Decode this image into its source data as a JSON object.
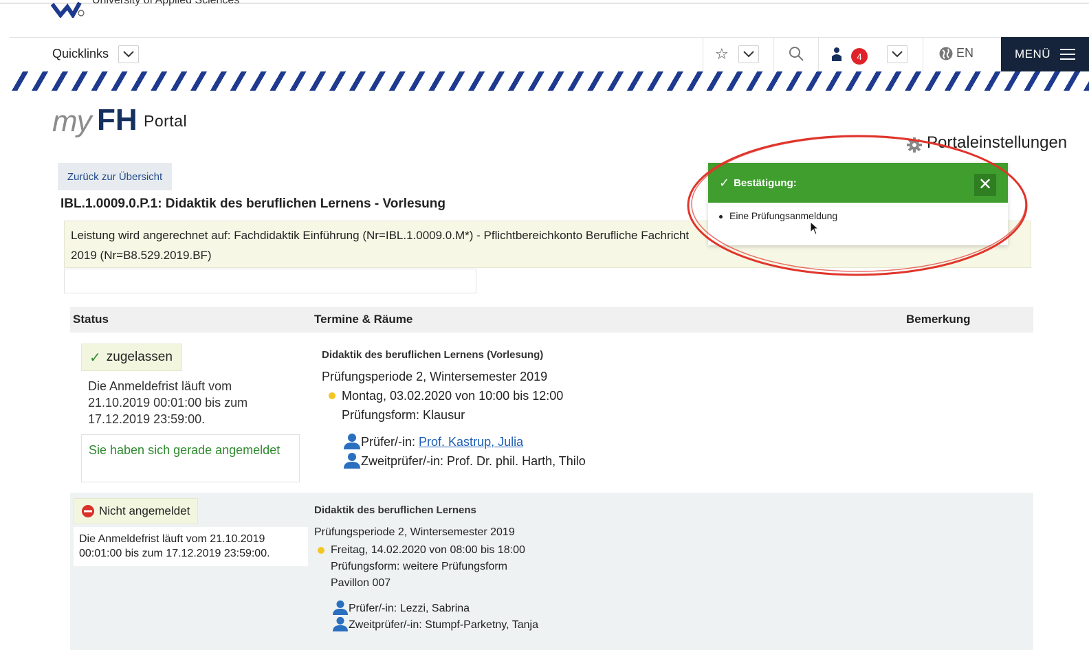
{
  "header": {
    "university_text": "University of Applied Sciences",
    "quicklinks_label": "Quicklinks",
    "notification_count": "4",
    "language_label": "EN",
    "menu_label": "MENÜ",
    "icons": [
      "logo-icon",
      "chevron-down-icon",
      "star-icon",
      "search-icon",
      "user-icon",
      "globe-icon",
      "hamburger-icon"
    ]
  },
  "portal": {
    "brand_my": "my",
    "brand_fh": "FH",
    "brand_portal": "Portal",
    "settings_label": "Portaleinstellungen"
  },
  "page": {
    "back_button": "Zurück zur Übersicht",
    "course_title": "IBL.1.0009.0.P.1: Didaktik des beruflichen Lernens - Vorlesung",
    "credit_info": "Leistung wird angerechnet auf: Fachdidaktik Einführung (Nr=IBL.1.0009.0.M*) - Pflichtbereichkonto Berufliche Fachricht",
    "credit_info_line2": "2019 (Nr=B8.529.2019.BF)"
  },
  "table": {
    "headers": [
      "Status",
      "Termine & Räume",
      "Bemerkung"
    ],
    "rows": [
      {
        "status": "zugelassen",
        "deadline": "Die Anmeldefrist läuft vom 21.10.2019 00:01:00 bis zum 17.12.2019 23:59:00.",
        "message": "Sie haben sich gerade angemeldet",
        "event_title": "Didaktik des beruflichen Lernens (Vorlesung)",
        "period": "Prüfungsperiode 2, Wintersemester 2019",
        "date": "Montag, 03.02.2020 von 10:00 bis 12:00",
        "form": "Prüfungsform: Klausur",
        "examiner_label": "Prüfer/-in:",
        "examiner_name": "Prof. Kastrup, Julia",
        "second_examiner": "Zweitprüfer/-in: Prof. Dr. phil. Harth, Thilo"
      },
      {
        "status": "Nicht angemeldet",
        "deadline": "Die Anmeldefrist läuft vom 21.10.2019 00:01:00 bis zum 17.12.2019 23:59:00.",
        "event_title": "Didaktik des beruflichen Lernens",
        "period": "Prüfungsperiode 2, Wintersemester 2019",
        "date": "Freitag, 14.02.2020 von 08:00 bis 18:00",
        "form": "Prüfungsform: weitere Prüfungsform",
        "room": "Pavillon 007",
        "examiner": "Prüfer/-in: Lezzi, Sabrina",
        "second_examiner": "Zweitprüfer/-in: Stumpf-Parketny, Tanja"
      }
    ]
  },
  "toast": {
    "title": "Bestätigung:",
    "items": [
      "Eine Prüfungsanmeldung"
    ],
    "close_symbol": "✕"
  },
  "colors": {
    "brand_navy": "#15305f",
    "stripe_blue": "#1d3a8f",
    "toast_green": "#3f9e2e",
    "success_green": "#2f8a2f",
    "link_blue": "#1f5fb4",
    "badge_red": "#e0232a",
    "annotation_red": "#e0352b"
  }
}
